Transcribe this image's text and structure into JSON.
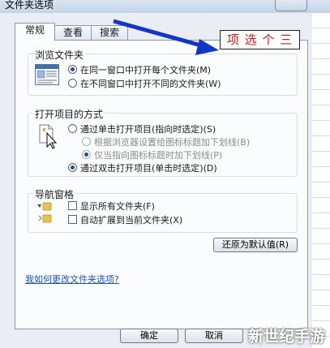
{
  "window": {
    "title": "文件夹选项"
  },
  "tabs": [
    {
      "label": "常规",
      "active": true
    },
    {
      "label": "查看",
      "active": false
    },
    {
      "label": "搜索",
      "active": false
    }
  ],
  "browse": {
    "legend": "浏览文件夹",
    "options": [
      {
        "label": "在同一窗口中打开每个文件夹(M)",
        "selected": true
      },
      {
        "label": "在不同窗口中打开不同的文件夹(W)",
        "selected": false
      }
    ]
  },
  "open_items": {
    "legend": "打开项目的方式",
    "options": [
      {
        "label": "通过单击打开项目(指向时选定)(S)",
        "selected": false,
        "disabled": false
      },
      {
        "label": "根据浏览器设置给图标标题加下划线(B)",
        "selected": false,
        "disabled": true
      },
      {
        "label": "仅当指向图标标题时加下划线(P)",
        "selected": true,
        "disabled": true
      },
      {
        "label": "通过双击打开项目(单击时选定)(D)",
        "selected": true,
        "disabled": false
      }
    ]
  },
  "nav_pane": {
    "legend": "导航窗格",
    "options": [
      {
        "label": "显示所有文件夹(F)",
        "checked": false
      },
      {
        "label": "自动扩展到当前文件夹(X)",
        "checked": false
      }
    ]
  },
  "buttons": {
    "restore": "还原为默认值(R)",
    "ok": "确定",
    "cancel": "取消"
  },
  "help_link": "我如何更改文件夹选项?",
  "annotation": "项 选 个 三",
  "watermark": "新世纪手游",
  "colors": {
    "arrow": "#1436c8",
    "annotation_text": "#d41b1b",
    "link": "#1a50c4"
  }
}
